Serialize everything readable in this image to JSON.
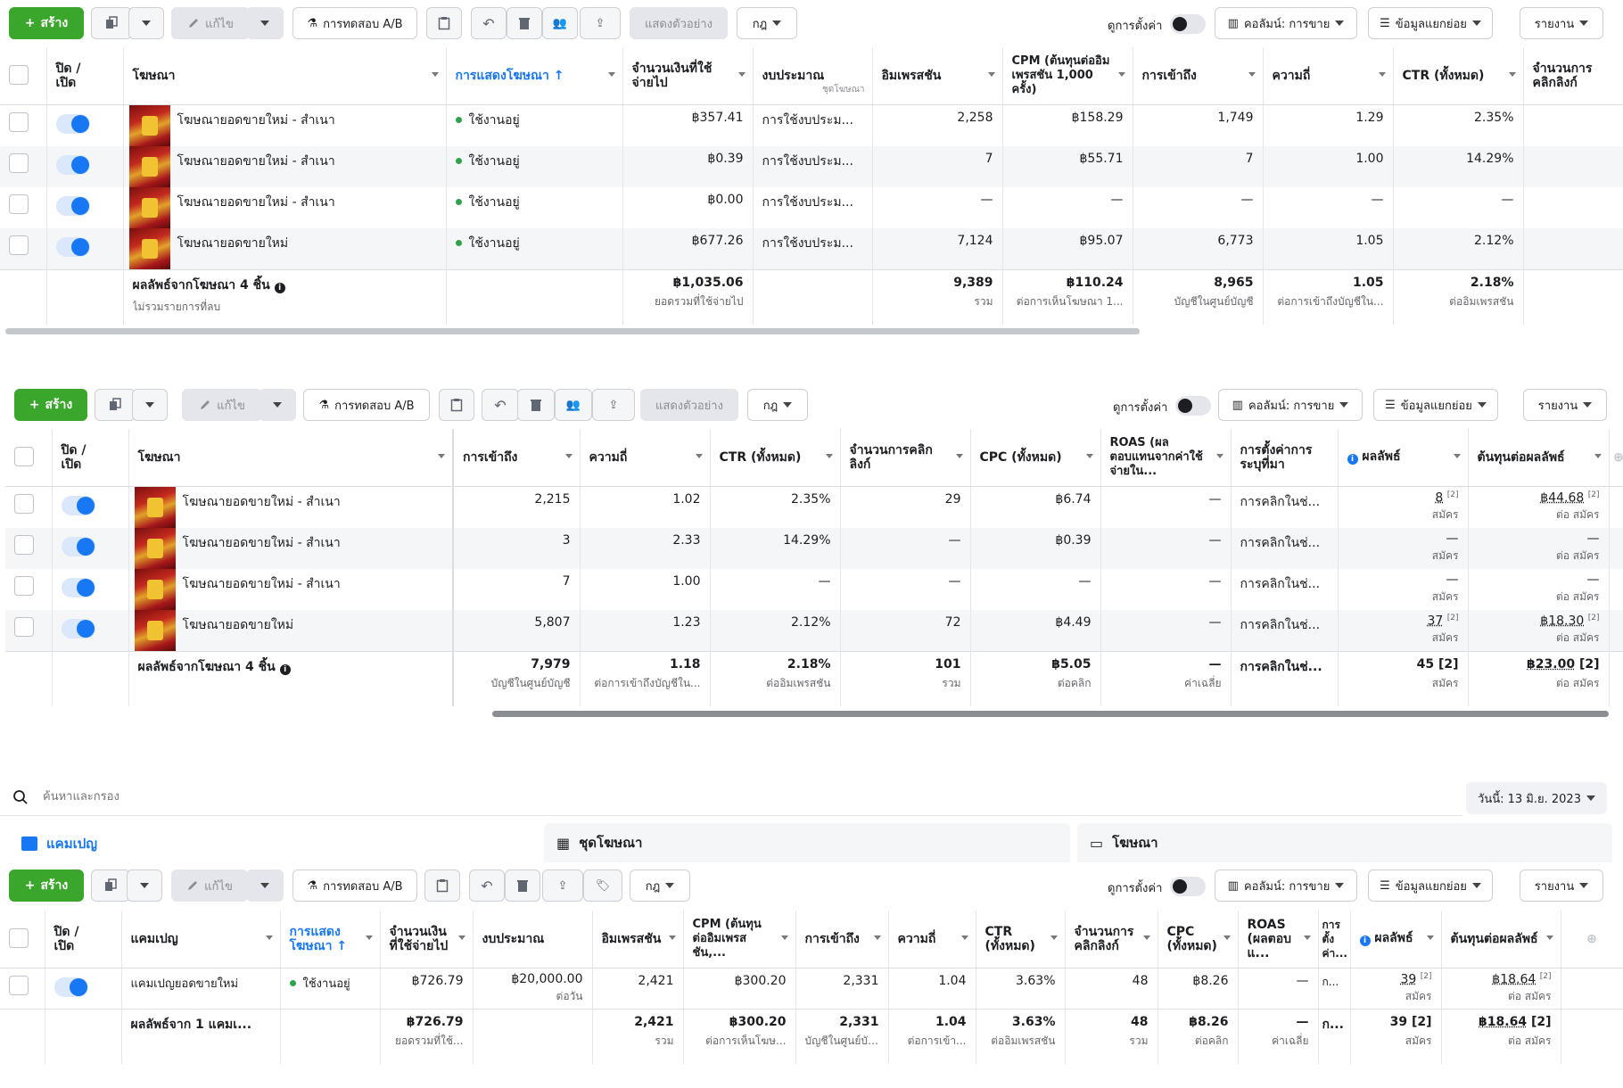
{
  "toolbar": {
    "create": "สร้าง",
    "edit": "แก้ไข",
    "ab_test": "การทดสอบ A/B",
    "preview": "แสดงตัวอย่าง",
    "rules": "กฎ",
    "view_settings": "ดูการตั้งค่า",
    "columns": "คอลัมน์: การขาย",
    "breakdown": "ข้อมูลแยกย่อย",
    "reports": "รายงาน"
  },
  "table1": {
    "headers": [
      "ปิด / เปิด",
      "โฆษณา",
      "การแสดงโฆษณา",
      "จำนวนเงินที่ใช้จ่ายไป",
      "งบประมาณ",
      "อิมเพรสชัน",
      "CPM (ต้นทุนต่ออิมเพรสชัน 1,000 ครั้ง)",
      "การเข้าถึง",
      "ความถี่",
      "CTR (ทั้งหมด)",
      "จำนวนการคลิกลิงก์"
    ],
    "budget_sub": "ชุดโฆษณา",
    "rows": [
      {
        "name": "โฆษณายอดขายใหม่ - สำเนา",
        "status": "ใช้งานอยู่",
        "spend": "฿357.41",
        "budget": "การใช้งบประม...",
        "impr": "2,258",
        "cpm": "฿158.29",
        "reach": "1,749",
        "freq": "1.29",
        "ctr": "2.35%"
      },
      {
        "name": "โฆษณายอดขายใหม่ - สำเนา",
        "status": "ใช้งานอยู่",
        "spend": "฿0.39",
        "budget": "การใช้งบประม...",
        "impr": "7",
        "cpm": "฿55.71",
        "reach": "7",
        "freq": "1.00",
        "ctr": "14.29%"
      },
      {
        "name": "โฆษณายอดขายใหม่ - สำเนา",
        "status": "ใช้งานอยู่",
        "spend": "฿0.00",
        "budget": "การใช้งบประม...",
        "impr": "—",
        "cpm": "—",
        "reach": "—",
        "freq": "—",
        "ctr": "—"
      },
      {
        "name": "โฆษณายอดขายใหม่",
        "status": "ใช้งานอยู่",
        "spend": "฿677.26",
        "budget": "การใช้งบประม...",
        "impr": "7,124",
        "cpm": "฿95.07",
        "reach": "6,773",
        "freq": "1.05",
        "ctr": "2.12%"
      }
    ],
    "total": {
      "label": "ผลลัพธ์จากโฆษณา 4 ชิ้น",
      "label_sub": "ไม่รวมรายการที่ลบ",
      "spend": "฿1,035.06",
      "spend_sub": "ยอดรวมที่ใช้จ่ายไป",
      "impr": "9,389",
      "impr_sub": "รวม",
      "cpm": "฿110.24",
      "cpm_sub": "ต่อการเห็นโฆษณา 1...",
      "reach": "8,965",
      "reach_sub": "บัญชีในศูนย์บัญชี",
      "freq": "1.05",
      "freq_sub": "ต่อการเข้าถึงบัญชีใน...",
      "ctr": "2.18%",
      "ctr_sub": "ต่ออิมเพรสชัน"
    }
  },
  "table2": {
    "headers": [
      "ปิด / เปิด",
      "โฆษณา",
      "การเข้าถึง",
      "ความถี่",
      "CTR (ทั้งหมด)",
      "จำนวนการคลิกลิงก์",
      "CPC (ทั้งหมด)",
      "ROAS (ผลตอบแทนจากค่าใช้จ่ายใน...",
      "การตั้งค่าการระบุที่มา",
      "ผลลัพธ์",
      "ต้นทุนต่อผลลัพธ์"
    ],
    "rows": [
      {
        "name": "โฆษณายอดขายใหม่ - สำเนา",
        "reach": "2,215",
        "freq": "1.02",
        "ctr": "2.35%",
        "clicks": "29",
        "cpc": "฿6.74",
        "roas": "—",
        "attr": "การคลิกในช่...",
        "res": "8",
        "res_sub": "สมัคร",
        "cost": "฿44.68",
        "cost_sub": "ต่อ สมัคร"
      },
      {
        "name": "โฆษณายอดขายใหม่ - สำเนา",
        "reach": "3",
        "freq": "2.33",
        "ctr": "14.29%",
        "clicks": "—",
        "cpc": "฿0.39",
        "roas": "—",
        "attr": "การคลิกในช่...",
        "res": "—",
        "res_sub": "สมัคร",
        "cost": "—",
        "cost_sub": "ต่อ สมัคร"
      },
      {
        "name": "โฆษณายอดขายใหม่ - สำเนา",
        "reach": "7",
        "freq": "1.00",
        "ctr": "—",
        "clicks": "—",
        "cpc": "—",
        "roas": "—",
        "attr": "การคลิกในช่...",
        "res": "—",
        "res_sub": "สมัคร",
        "cost": "—",
        "cost_sub": "ต่อ สมัคร"
      },
      {
        "name": "โฆษณายอดขายใหม่",
        "reach": "5,807",
        "freq": "1.23",
        "ctr": "2.12%",
        "clicks": "72",
        "cpc": "฿4.49",
        "roas": "—",
        "attr": "การคลิกในช่...",
        "res": "37",
        "res_sub": "สมัคร",
        "cost": "฿18.30",
        "cost_sub": "ต่อ สมัคร"
      }
    ],
    "total": {
      "label": "ผลลัพธ์จากโฆษณา 4 ชิ้น",
      "reach": "7,979",
      "reach_sub": "บัญชีในศูนย์บัญชี",
      "freq": "1.18",
      "freq_sub": "ต่อการเข้าถึงบัญชีใน...",
      "ctr": "2.18%",
      "ctr_sub": "ต่ออิมเพรสชัน",
      "clicks": "101",
      "clicks_sub": "รวม",
      "cpc": "฿5.05",
      "cpc_sub": "ต่อคลิก",
      "roas": "—",
      "roas_sub": "ค่าเฉลี่ย",
      "attr": "การคลิกในช่...",
      "res": "45",
      "res_sub": "สมัคร",
      "cost": "฿23.00",
      "cost_sub": "ต่อ สมัคร"
    },
    "marker": "[2]"
  },
  "search": {
    "placeholder": "ค้นหาและกรอง",
    "date": "วันนี้: 13 มิ.ย. 2023"
  },
  "tabs": {
    "campaigns": "แคมเปญ",
    "adsets": "ชุดโฆษณา",
    "ads": "โฆษณา"
  },
  "table3": {
    "headers": [
      "ปิด / เปิด",
      "แคมเปญ",
      "การแสดงโฆษณา",
      "จำนวนเงินที่ใช้จ่ายไป",
      "งบประมาณ",
      "อิมเพรสชัน",
      "CPM (ต้นทุนต่ออิมเพรสชัน,...",
      "การเข้าถึง",
      "ความถี่",
      "CTR (ทั้งหมด)",
      "จำนวนการคลิกลิงก์",
      "CPC (ทั้งหมด)",
      "ROAS (ผลตอบแ...",
      "การตั้งค่า...",
      "ผลลัพธ์",
      "ต้นทุนต่อผลลัพธ์"
    ],
    "row": {
      "name": "แคมเปญยอดขายใหม่",
      "status": "ใช้งานอยู่",
      "spend": "฿726.79",
      "budget": "฿20,000.00",
      "budget_sub": "ต่อวัน",
      "impr": "2,421",
      "cpm": "฿300.20",
      "reach": "2,331",
      "freq": "1.04",
      "ctr": "3.63%",
      "clicks": "48",
      "cpc": "฿8.26",
      "roas": "—",
      "attr": "ก...",
      "res": "39",
      "res_sub": "สมัคร",
      "cost": "฿18.64",
      "cost_sub": "ต่อ สมัคร"
    },
    "total": {
      "label": "ผลลัพธ์จาก 1 แคมเ...",
      "spend": "฿726.79",
      "spend_sub": "ยอดรวมที่ใช้...",
      "impr": "2,421",
      "impr_sub": "รวม",
      "cpm": "฿300.20",
      "cpm_sub": "ต่อการเห็นโฆษ...",
      "reach": "2,331",
      "reach_sub": "บัญชีในศูนย์บัญ...",
      "freq": "1.04",
      "freq_sub": "ต่อการเข้า...",
      "ctr": "3.63%",
      "ctr_sub": "ต่ออิมเพรสชัน",
      "clicks": "48",
      "clicks_sub": "รวม",
      "cpc": "฿8.26",
      "cpc_sub": "ต่อคลิก",
      "roas": "—",
      "roas_sub": "ค่าเฉลี่ย",
      "attr": "ก...",
      "res": "39",
      "res_sub": "สมัคร",
      "cost": "฿18.64",
      "cost_sub": "ต่อ สมัคร"
    }
  }
}
